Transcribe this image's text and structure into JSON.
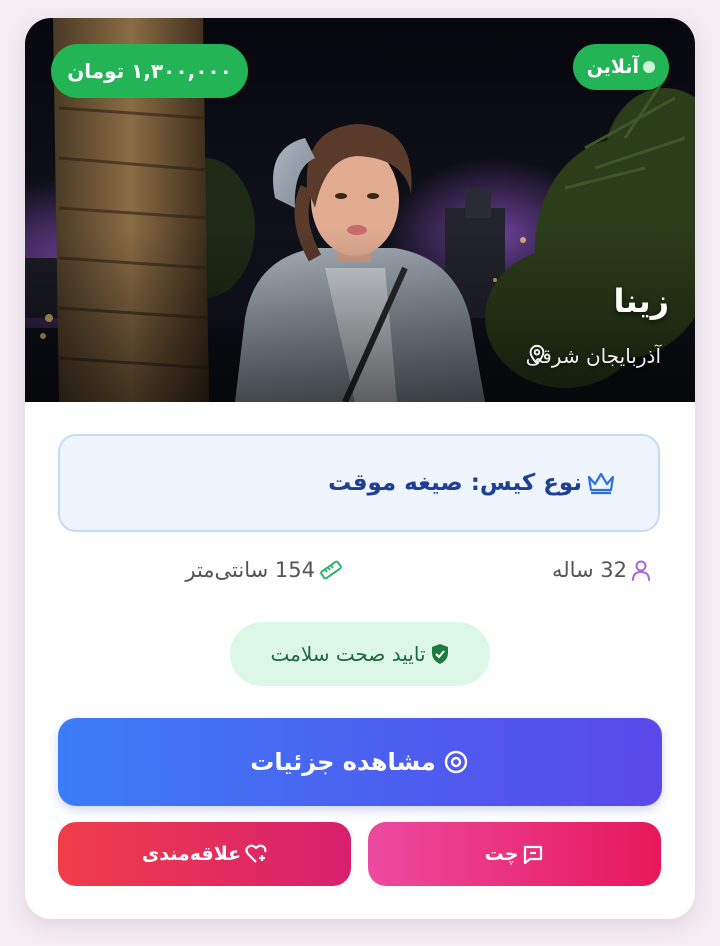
{
  "profile": {
    "name": "زینا",
    "location": "آذربایجان شرقی",
    "price": "۱,۳۰۰,۰۰۰ تومان",
    "status": "آنلاین",
    "case_type": "نوع کیس: صیغه موقت",
    "age": "32 ساله",
    "height": "154 سانتی‌متر",
    "health": "تایید صحت سلامت"
  },
  "actions": {
    "details_label": "مشاهده جزئیات",
    "chat_label": "چت",
    "interest_label": "علاقه‌مندی"
  },
  "colors": {
    "accent_green": "#22b455",
    "details_gradient": [
      "#3b7df6",
      "#5a48ea"
    ],
    "chat_gradient": [
      "#ec4aa0",
      "#e7185a"
    ],
    "interest_gradient": [
      "#ef3e4a",
      "#d81f6e"
    ],
    "case_text": "#1f3f92"
  },
  "icons": {
    "online": "status-dot-icon",
    "location": "map-pin-icon",
    "case": "crown-icon",
    "age": "user-icon",
    "height": "ruler-icon",
    "health": "shield-check-icon",
    "details": "eye-icon",
    "chat": "chat-icon",
    "interest": "heart-plus-icon"
  }
}
